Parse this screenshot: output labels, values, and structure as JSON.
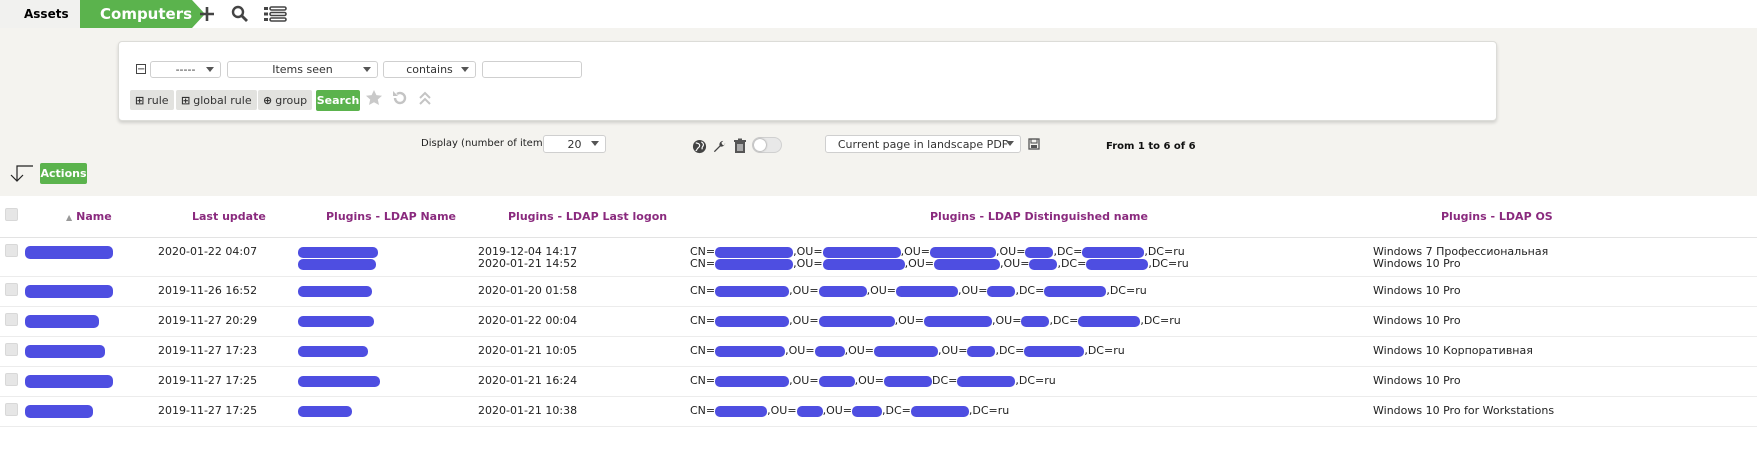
{
  "breadcrumb": {
    "assets": "Assets",
    "computers": "Computers"
  },
  "toolbar": {
    "icons": [
      "plus-icon",
      "search-icon",
      "list-icon"
    ]
  },
  "search": {
    "field_select": "-----",
    "criteria_select": "Items seen",
    "operator_select": "contains",
    "value_input": "",
    "rule_button": "rule",
    "global_rule_button": "global rule",
    "group_button": "group",
    "search_button": "Search"
  },
  "display": {
    "label": "Display (number of items)",
    "per_page": "20",
    "export_select": "Current page in landscape PDF",
    "pager_text": "From 1 to 6 of 6"
  },
  "actions_button": "Actions",
  "colors": {
    "accent_green": "#5bb34d",
    "header_purple": "#8a2a7e",
    "redaction": "#3f3fde"
  },
  "table": {
    "columns": [
      "Name",
      "Last update",
      "Plugins - LDAP Name",
      "Plugins - LDAP Last logon",
      "Plugins - LDAP Distinguished name",
      "Plugins - LDAP OS"
    ],
    "rows": [
      {
        "last_update": "2020-01-22 04:07",
        "last_logon": [
          "2019-12-04 14:17",
          "2020-01-21 14:52"
        ],
        "dn": [
          [
            "CN=",
            ",OU=",
            ",OU=",
            ",OU=",
            ",DC=",
            ",DC=ru"
          ],
          [
            "CN=",
            ",OU=",
            ",OU=",
            ",OU=",
            ",DC=",
            ",DC=ru"
          ]
        ],
        "os": [
          "Windows 7 Профессиональная",
          "Windows 10 Pro"
        ]
      },
      {
        "last_update": "2019-11-26 16:52",
        "last_logon": [
          "2020-01-20 01:58"
        ],
        "dn": [
          [
            "CN=",
            ",OU=",
            ",OU=",
            ",OU=",
            ",DC=",
            ",DC=ru"
          ]
        ],
        "os": [
          "Windows 10 Pro"
        ]
      },
      {
        "last_update": "2019-11-27 20:29",
        "last_logon": [
          "2020-01-22 00:04"
        ],
        "dn": [
          [
            "CN=",
            ",OU=",
            ",OU=",
            ",OU=",
            ",DC=",
            ",DC=ru"
          ]
        ],
        "os": [
          "Windows 10 Pro"
        ]
      },
      {
        "last_update": "2019-11-27 17:23",
        "last_logon": [
          "2020-01-21 10:05"
        ],
        "dn": [
          [
            "CN=",
            ",OU=",
            ",OU=",
            ",OU=",
            ",DC=",
            ",DC=ru"
          ]
        ],
        "os": [
          "Windows 10 Корпоративная"
        ]
      },
      {
        "last_update": "2019-11-27 17:25",
        "last_logon": [
          "2020-01-21 16:24"
        ],
        "dn": [
          [
            "CN=",
            ",OU=",
            ",OU=",
            "DC=",
            ",DC=ru"
          ]
        ],
        "os": [
          "Windows 10 Pro"
        ]
      },
      {
        "last_update": "2019-11-27 17:25",
        "last_logon": [
          "2020-01-21 10:38"
        ],
        "dn": [
          [
            "CN=",
            ",OU=",
            ",OU=",
            ",DC=",
            ",DC=ru"
          ]
        ],
        "os": [
          "Windows 10 Pro for Workstations"
        ]
      }
    ]
  }
}
